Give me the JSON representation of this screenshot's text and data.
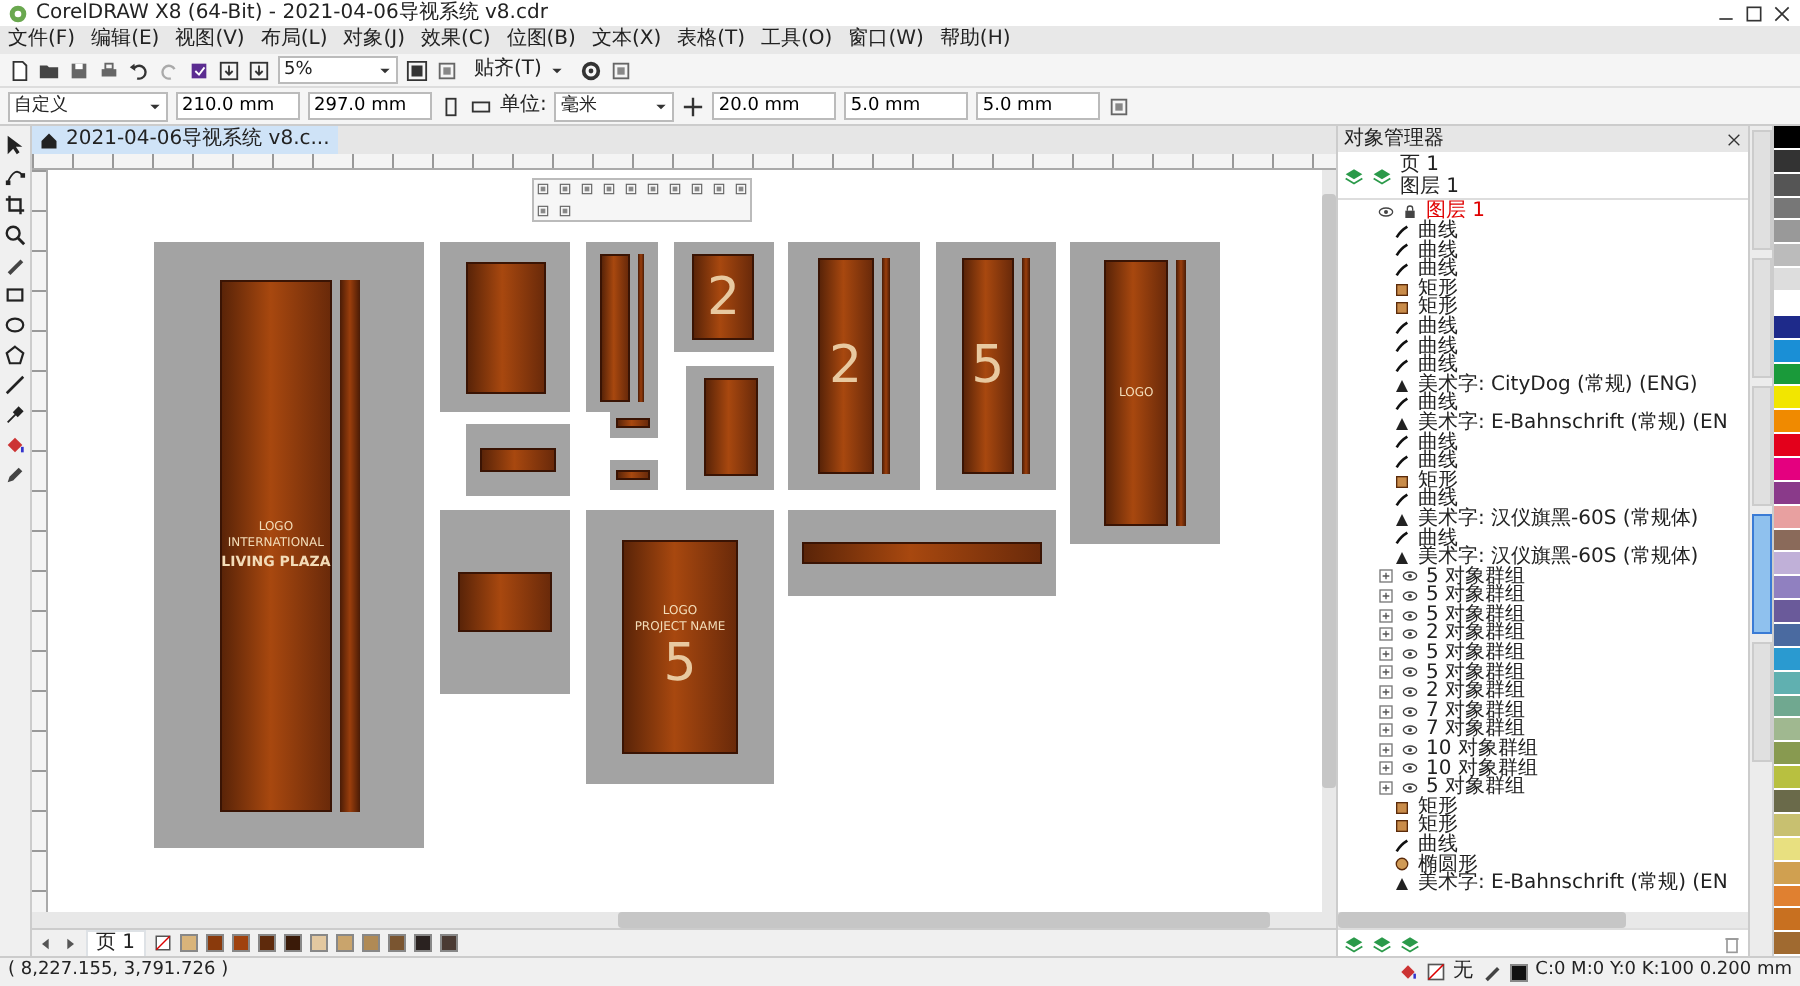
{
  "window": {
    "title": "CorelDRAW X8 (64-Bit) - 2021-04-06导视系统 v8.cdr"
  },
  "menu": [
    {
      "label": "文件(F)"
    },
    {
      "label": "编辑(E)"
    },
    {
      "label": "视图(V)"
    },
    {
      "label": "布局(L)"
    },
    {
      "label": "对象(J)"
    },
    {
      "label": "效果(C)"
    },
    {
      "label": "位图(B)"
    },
    {
      "label": "文本(X)"
    },
    {
      "label": "表格(T)"
    },
    {
      "label": "工具(O)"
    },
    {
      "label": "窗口(W)"
    },
    {
      "label": "帮助(H)"
    }
  ],
  "toolbar": {
    "zoom": "5%",
    "snap": "贴齐(T)"
  },
  "property_bar": {
    "page_size": "自定义",
    "width": "210.0 mm",
    "height": "297.0 mm",
    "units_label": "单位:",
    "units": "毫米",
    "nudge": "20.0 mm",
    "dup_x": "5.0 mm",
    "dup_y": "5.0 mm"
  },
  "document_tabs": [
    {
      "label": "2021-04-06导视系统 v8.c...",
      "selected": true
    }
  ],
  "artboards": [
    {
      "kind": "totem",
      "texts": [
        {
          "text": "LOGO",
          "kind": "label"
        },
        {
          "text": "INTERNATIONAL",
          "kind": "label"
        },
        {
          "text": "LIVING PLAZA",
          "kind": "title"
        }
      ]
    },
    {
      "kind": "panel"
    },
    {
      "kind": "totem"
    },
    {
      "kind": "panel",
      "texts": [
        {
          "text": "2",
          "kind": "number"
        }
      ]
    },
    {
      "kind": "totem",
      "texts": [
        {
          "text": "2",
          "kind": "number"
        }
      ]
    },
    {
      "kind": "totem",
      "texts": [
        {
          "text": "5",
          "kind": "number"
        }
      ]
    },
    {
      "kind": "totem",
      "texts": [
        {
          "text": "LOGO",
          "kind": "label"
        }
      ]
    },
    {
      "kind": "bar"
    },
    {
      "kind": "bar"
    },
    {
      "kind": "bar"
    },
    {
      "kind": "panel"
    },
    {
      "kind": "bar"
    },
    {
      "kind": "panel",
      "texts": [
        {
          "text": "LOGO",
          "kind": "label"
        },
        {
          "text": "PROJECT NAME",
          "kind": "label"
        },
        {
          "text": "5",
          "kind": "number"
        }
      ]
    },
    {
      "kind": "wide"
    }
  ],
  "page_tabs": [
    {
      "label": "页 1",
      "selected": true
    }
  ],
  "document_palette": [
    {
      "color": "#d9b47a"
    },
    {
      "color": "#8a3a0c"
    },
    {
      "color": "#a0420e"
    },
    {
      "color": "#5e2a0c"
    },
    {
      "color": "#3a1a08"
    },
    {
      "color": "#e3c8a0"
    },
    {
      "color": "#c9a46c"
    },
    {
      "color": "#b08a55"
    },
    {
      "color": "#7a5530"
    },
    {
      "color": "#2a2220"
    },
    {
      "color": "#4a3a33"
    }
  ],
  "docker_tabs": [
    {
      "selected": false
    },
    {
      "selected": false
    },
    {
      "selected": false
    },
    {
      "selected": true
    },
    {
      "selected": false
    }
  ],
  "object_manager": {
    "title": "对象管理器",
    "page": "页 1",
    "layer": "图层 1",
    "layer_node": "图层 1",
    "items": [
      {
        "kind": "curve",
        "label": "曲线"
      },
      {
        "kind": "curve",
        "label": "曲线"
      },
      {
        "kind": "curve",
        "label": "曲线"
      },
      {
        "kind": "rect",
        "label": "矩形"
      },
      {
        "kind": "rect",
        "label": "矩形"
      },
      {
        "kind": "curve",
        "label": "曲线"
      },
      {
        "kind": "curve",
        "label": "曲线"
      },
      {
        "kind": "curve",
        "label": "曲线"
      },
      {
        "kind": "text",
        "label": "美术字: CityDog (常规) (ENG)"
      },
      {
        "kind": "curve",
        "label": "曲线"
      },
      {
        "kind": "text",
        "label": "美术字: E-Bahnschrift (常规) (EN"
      },
      {
        "kind": "curve",
        "label": "曲线"
      },
      {
        "kind": "curve",
        "label": "曲线"
      },
      {
        "kind": "rect",
        "label": "矩形"
      },
      {
        "kind": "curve",
        "label": "曲线"
      },
      {
        "kind": "text",
        "label": "美术字: 汉仪旗黑-60S (常规体)"
      },
      {
        "kind": "curve",
        "label": "曲线"
      },
      {
        "kind": "text",
        "label": "美术字: 汉仪旗黑-60S (常规体)"
      },
      {
        "kind": "group",
        "label": "5 对象群组"
      },
      {
        "kind": "group",
        "label": "5 对象群组"
      },
      {
        "kind": "group",
        "label": "5 对象群组"
      },
      {
        "kind": "group",
        "label": "2 对象群组"
      },
      {
        "kind": "group",
        "label": "5 对象群组"
      },
      {
        "kind": "group",
        "label": "5 对象群组"
      },
      {
        "kind": "group",
        "label": "2 对象群组"
      },
      {
        "kind": "group",
        "label": "7 对象群组"
      },
      {
        "kind": "group",
        "label": "7 对象群组"
      },
      {
        "kind": "group",
        "label": "10 对象群组"
      },
      {
        "kind": "group",
        "label": "10 对象群组"
      },
      {
        "kind": "group",
        "label": "5 对象群组"
      },
      {
        "kind": "rect",
        "label": "矩形"
      },
      {
        "kind": "rect",
        "label": "矩形"
      },
      {
        "kind": "curve",
        "label": "曲线"
      },
      {
        "kind": "ellipse",
        "label": "椭圆形"
      },
      {
        "kind": "text",
        "label": "美术字: E-Bahnschrift (常规) (EN"
      }
    ]
  },
  "color_palette": [
    {
      "color": "#000000"
    },
    {
      "color": "#333333"
    },
    {
      "color": "#555555"
    },
    {
      "color": "#777777"
    },
    {
      "color": "#999999"
    },
    {
      "color": "#bbbbbb"
    },
    {
      "color": "#dddddd"
    },
    {
      "color": "#ffffff"
    },
    {
      "color": "#1e2a8a"
    },
    {
      "color": "#1a8fd6"
    },
    {
      "color": "#1a9a3a"
    },
    {
      "color": "#f2e600"
    },
    {
      "color": "#f08a00"
    },
    {
      "color": "#e3001b"
    },
    {
      "color": "#e4007f"
    },
    {
      "color": "#8a3a8a"
    },
    {
      "color": "#e8a0a0"
    },
    {
      "color": "#8a6a5a"
    },
    {
      "color": "#c0b0d8"
    },
    {
      "color": "#9080c0"
    },
    {
      "color": "#6a5a9a"
    },
    {
      "color": "#4a6aa0"
    },
    {
      "color": "#2a9ad0"
    },
    {
      "color": "#60b0b0"
    },
    {
      "color": "#70a890"
    },
    {
      "color": "#a0b890"
    },
    {
      "color": "#889a50"
    },
    {
      "color": "#b8c040"
    },
    {
      "color": "#6a6a4a"
    },
    {
      "color": "#c8c070"
    },
    {
      "color": "#e8e080"
    },
    {
      "color": "#d0a050"
    },
    {
      "color": "#e08030"
    },
    {
      "color": "#c87020"
    },
    {
      "color": "#a06a30"
    }
  ],
  "status_bar": {
    "coordinates": "( 8,227.155, 3,791.726 )",
    "fill": "无",
    "outline": "C:0 M:0 Y:0 K:100 0.200 mm"
  }
}
